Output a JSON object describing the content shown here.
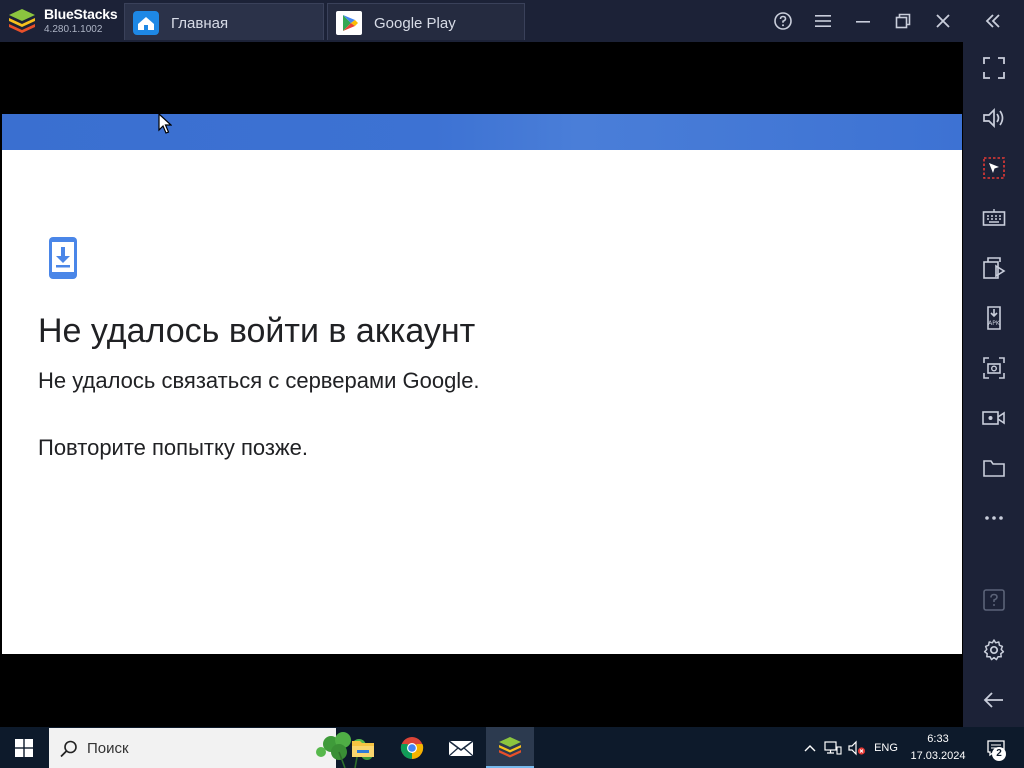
{
  "app": {
    "name": "BlueStacks",
    "version": "4.280.1.1002"
  },
  "tabs": [
    {
      "label": "Главная",
      "icon": "home-icon"
    },
    {
      "label": "Google Play",
      "icon": "google-play-icon"
    }
  ],
  "window_controls": [
    "help-icon",
    "menu-icon",
    "minimize-icon",
    "restore-icon",
    "close-icon",
    "collapse-sidebar-icon"
  ],
  "sidebar": {
    "items": [
      "fullscreen-icon",
      "volume-icon",
      "pointer-lock-icon",
      "keyboard-icon",
      "multi-instance-icon",
      "install-apk-icon",
      "screenshot-icon",
      "record-icon",
      "folder-icon",
      "more-icon",
      "help-icon",
      "settings-icon",
      "back-icon"
    ]
  },
  "dialog": {
    "title": "Не удалось войти в аккаунт",
    "message": "Не удалось связаться с серверами Google.",
    "retry": "Повторите попытку позже."
  },
  "taskbar": {
    "search_placeholder": "Поиск",
    "language": "ENG",
    "time": "6:33",
    "date": "17.03.2024",
    "notifications": "2"
  },
  "colors": {
    "title_bar": "#1c2237",
    "accent_blue": "#3d72d3",
    "taskbar": "#0d1a2b"
  }
}
